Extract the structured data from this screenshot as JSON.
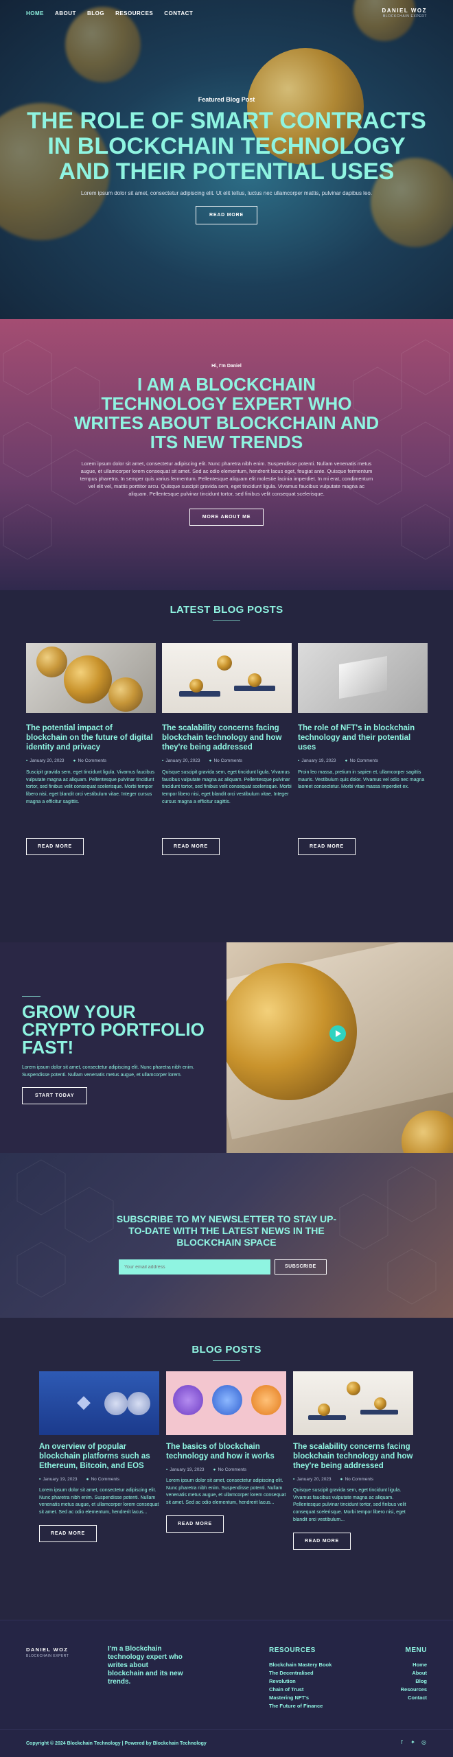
{
  "nav": {
    "items": [
      "HOME",
      "ABOUT",
      "BLOG",
      "RESOURCES",
      "CONTACT"
    ]
  },
  "brand": {
    "name": "DANIEL WOZ",
    "sub": "BLOCKCHAIN EXPERT"
  },
  "hero": {
    "kicker": "Featured Blog Post",
    "title": "THE ROLE OF SMART CONTRACTS IN BLOCKCHAIN TECHNOLOGY AND THEIR POTENTIAL USES",
    "subtitle": "Lorem ipsum dolor sit amet, consectetur adipiscing elit. Ut elit tellus, luctus nec ullamcorper mattis, pulvinar dapibus leo.",
    "button": "READ MORE"
  },
  "about": {
    "kicker": "Hi, I'm Daniel",
    "title": "I AM A BLOCKCHAIN TECHNOLOGY EXPERT WHO WRITES ABOUT BLOCKCHAIN AND ITS NEW TRENDS",
    "text": "Lorem ipsum dolor sit amet, consectetur adipiscing elit. Nunc pharetra nibh enim. Suspendisse potenti. Nullam venenatis metus augue, et ullamcorper lorem consequat sit amet. Sed ac odio elementum, hendrerit lacus eget, feugiat ante. Quisque fermentum tempus pharetra. In semper quis varius fermentum. Pellentesque aliquam elit molestie lacinia imperdiet. In mi erat, condimentum vel elit vel, mattis porttitor arcu. Quisque suscipit gravida sem, eget tincidunt ligula. Vivamus faucibus vulputate magna ac aliquam. Pellentesque pulvinar tincidunt tortor, sed finibus velit consequat scelerisque.",
    "button": "MORE ABOUT ME"
  },
  "latest": {
    "title": "LATEST BLOG POSTS",
    "cards": [
      {
        "title": "The potential impact of blockchain on the future of digital identity and privacy",
        "date": "January 20, 2023",
        "comments": "No Comments",
        "text": "Suscipit gravida sem, eget tincidunt ligula. Vivamus faucibus vulputate magna ac aliquam. Pellentesque pulvinar tincidunt tortor, sed finibus velit consequat scelerisque. Morbi tempor libero nisi, eget blandit orci vestibulum vitae. Integer cursus magna a efficitur sagittis.",
        "button": "READ MORE"
      },
      {
        "title": "The scalability concerns facing blockchain technology and how they're being addressed",
        "date": "January 20, 2023",
        "comments": "No Comments",
        "text": "Quisque suscipit gravida sem, eget tincidunt ligula. Vivamus faucibus vulputate magna ac aliquam. Pellentesque pulvinar tincidunt tortor, sed finibus velit consequat scelerisque. Morbi tempor libero nisi, eget blandit orci vestibulum vitae. Integer cursus magna a efficitur sagittis.",
        "button": "READ MORE"
      },
      {
        "title": "The role of NFT's in blockchain technology and their potential uses",
        "date": "January 19, 2023",
        "comments": "No Comments",
        "text": "Proin leo massa, pretium in sapien et, ullamcorper sagittis mauris. Vestibulum quis dolor. Vivamus vel odio nec magna laoreet consectetur. Morbi vitae massa imperdiet ex.",
        "button": "READ MORE"
      }
    ]
  },
  "grow": {
    "title": "GROW YOUR CRYPTO PORTFOLIO FAST!",
    "text": "Lorem ipsum dolor sit amet, consectetur adipiscing elit. Nunc pharetra nibh enim. Suspendisse potenti. Nullam venenatis metus augue, et ullamcorper lorem.",
    "button": "START TODAY"
  },
  "newsletter": {
    "title": "SUBSCRIBE TO MY NEWSLETTER TO STAY UP-TO-DATE WITH THE LATEST NEWS IN THE BLOCKCHAIN SPACE",
    "placeholder": "Your email address",
    "button": "SUBSCRIBE"
  },
  "blog": {
    "title": "BLOG POSTS",
    "cards": [
      {
        "title": "An overview of popular blockchain platforms such as Ethereum, Bitcoin, and EOS",
        "date": "January 19, 2023",
        "comments": "No Comments",
        "text": "Lorem ipsum dolor sit amet, consectetur adipiscing elit. Nunc pharetra nibh enim. Suspendisse potenti. Nullam venenatis metus augue, et ullamcorper lorem consequat sit amet. Sed ac odio elementum, hendrerit lacus...",
        "button": "READ MORE"
      },
      {
        "title": "The basics of blockchain technology and how it works",
        "date": "January 19, 2023",
        "comments": "No Comments",
        "text": "Lorem ipsum dolor sit amet, consectetur adipiscing elit. Nunc pharetra nibh enim. Suspendisse potenti. Nullam venenatis metus augue, et ullamcorper lorem consequat sit amet. Sed ac odio elementum, hendrerit lacus...",
        "button": "READ MORE"
      },
      {
        "title": "The scalability concerns facing blockchain technology and how they're being addressed",
        "date": "January 20, 2023",
        "comments": "No Comments",
        "text": "Quisque suscipit gravida sem, eget tincidunt ligula. Vivamus faucibus vulputate magna ac aliquam. Pellentesque pulvinar tincidunt tortor, sed finibus velit consequat scelerisque. Morbi tempor libero nisi, eget blandit orci vestibulum...",
        "button": "READ MORE"
      }
    ]
  },
  "footer": {
    "brand": "DANIEL WOZ",
    "brand_sub": "BLOCKCHAIN EXPERT",
    "tagline": "I'm a Blockchain technology expert who writes about blockchain and its new trends.",
    "resources_title": "RESOURCES",
    "resources": [
      "Blockchain Mastery Book",
      "The Decentralised",
      "Revolution",
      "Chain of Trust",
      "Mastering NFT's",
      "The Future of Finance"
    ],
    "menu_title": "MENU",
    "menu": [
      "Home",
      "About",
      "Blog",
      "Resources",
      "Contact"
    ],
    "copyright": "Copyright © 2024 Blockchain Technology | Powered by Blockchain Technology",
    "social": [
      "facebook-icon",
      "twitter-icon",
      "instagram-icon"
    ]
  },
  "colors": {
    "accent": "#8ff4e1",
    "bg": "#24233f",
    "about_top": "#a44d72"
  }
}
